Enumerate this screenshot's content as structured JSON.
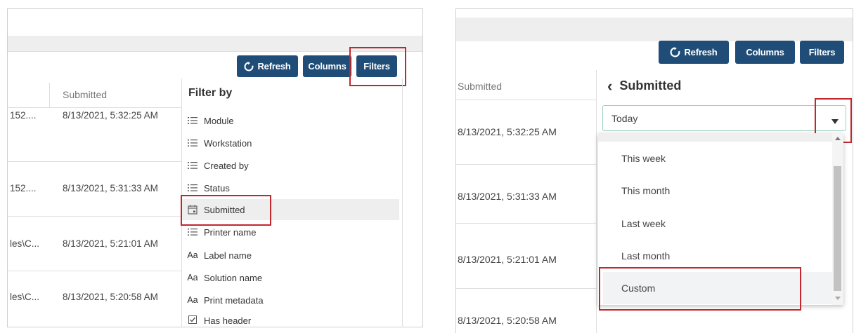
{
  "toolbar": {
    "refresh_label": "Refresh",
    "columns_label": "Columns",
    "filters_label": "Filters"
  },
  "left_panel": {
    "column_header": "Submitted",
    "rows": [
      {
        "prefix": "152....",
        "submitted": "8/13/2021, 5:32:25 AM"
      },
      {
        "prefix": "152....",
        "submitted": "8/13/2021, 5:31:33 AM"
      },
      {
        "prefix": "les\\C...",
        "submitted": "8/13/2021, 5:21:01 AM"
      },
      {
        "prefix": "les\\C...",
        "submitted": "8/13/2021, 5:20:58 AM"
      }
    ],
    "filter_panel": {
      "title": "Filter by",
      "items": [
        {
          "label": "Module",
          "icon": "list-icon"
        },
        {
          "label": "Workstation",
          "icon": "list-icon"
        },
        {
          "label": "Created by",
          "icon": "list-icon"
        },
        {
          "label": "Status",
          "icon": "list-icon"
        },
        {
          "label": "Submitted",
          "icon": "calendar-icon"
        },
        {
          "label": "Printer name",
          "icon": "list-icon"
        },
        {
          "label": "Label name",
          "icon": "text-icon",
          "glyph": "Aa"
        },
        {
          "label": "Solution name",
          "icon": "text-icon",
          "glyph": "Aa"
        },
        {
          "label": "Print metadata",
          "icon": "text-icon",
          "glyph": "Aa"
        },
        {
          "label": "Has header",
          "icon": "checkbox-icon"
        }
      ]
    }
  },
  "right_panel": {
    "column_header": "Submitted",
    "rows": [
      {
        "submitted": "8/13/2021, 5:32:25 AM"
      },
      {
        "submitted": "8/13/2021, 5:31:33 AM"
      },
      {
        "submitted": "8/13/2021, 5:21:01 AM"
      },
      {
        "submitted": "8/13/2021, 5:20:58 AM"
      }
    ],
    "filter_title": "Submitted",
    "back_glyph": "‹",
    "select_value": "Today",
    "options": [
      "This week",
      "This month",
      "Last week",
      "Last month",
      "Custom"
    ]
  },
  "colors": {
    "button_bg": "#1f4d78",
    "highlight": "#c1272d",
    "select_border": "#9fcfbf"
  }
}
